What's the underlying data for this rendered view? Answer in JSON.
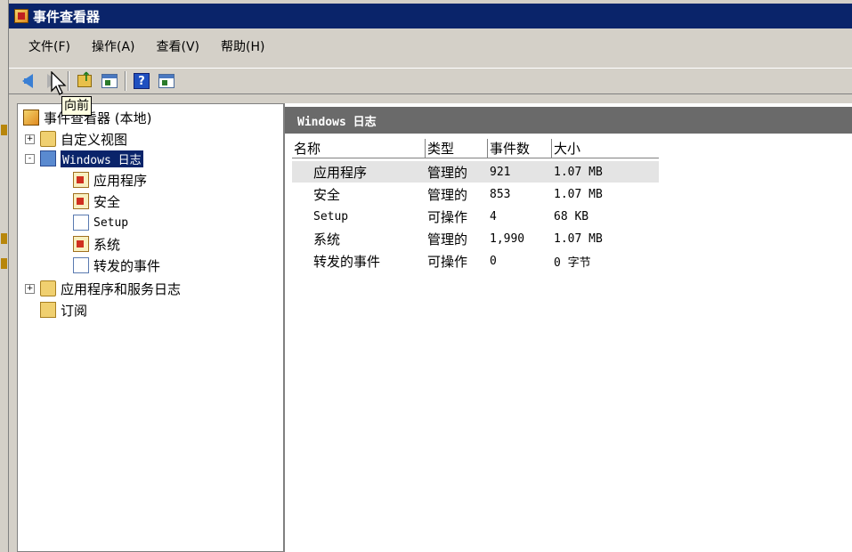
{
  "window": {
    "title": "事件查看器"
  },
  "menu": {
    "items": [
      "文件(F)",
      "操作(A)",
      "查看(V)",
      "帮助(H)"
    ]
  },
  "toolbar": {
    "tooltip": "向前",
    "icons": [
      "back-arrow-icon",
      "forward-arrow-icon",
      "up-folder-icon",
      "show-hide-tree-icon",
      "help-icon",
      "show-hide-action-pane-icon"
    ]
  },
  "tree": {
    "root": "事件查看器 (本地)",
    "items": [
      {
        "label": "自定义视图",
        "icon": "folder-icon",
        "expander": "+"
      },
      {
        "label": "Windows 日志",
        "icon": "windows-logs-icon",
        "expander": "-"
      },
      {
        "label": "应用程序",
        "icon": "log-warning-icon"
      },
      {
        "label": "安全",
        "icon": "log-warning-icon"
      },
      {
        "label": "Setup",
        "icon": "log-icon"
      },
      {
        "label": "系统",
        "icon": "log-warning-icon"
      },
      {
        "label": "转发的事件",
        "icon": "log-icon"
      },
      {
        "label": "应用程序和服务日志",
        "icon": "folder-icon",
        "expander": "+"
      },
      {
        "label": "订阅",
        "icon": "subscription-icon"
      }
    ]
  },
  "main": {
    "header": "Windows 日志",
    "columns": [
      "名称",
      "类型",
      "事件数",
      "大小"
    ],
    "rows": [
      {
        "name": "应用程序",
        "type": "管理的",
        "count": "921",
        "size": "1.07 MB"
      },
      {
        "name": "安全",
        "type": "管理的",
        "count": "853",
        "size": "1.07 MB"
      },
      {
        "name": "Setup",
        "type": "可操作",
        "count": "4",
        "size": "68 KB"
      },
      {
        "name": "系统",
        "type": "管理的",
        "count": "1,990",
        "size": "1.07 MB"
      },
      {
        "name": "转发的事件",
        "type": "可操作",
        "count": "0",
        "size": "0 字节"
      }
    ]
  },
  "colors": {
    "titlebar": "#0a246a",
    "selection": "#0a246a",
    "panel_header": "#6a6a6a",
    "chrome": "#d4d0c8"
  }
}
